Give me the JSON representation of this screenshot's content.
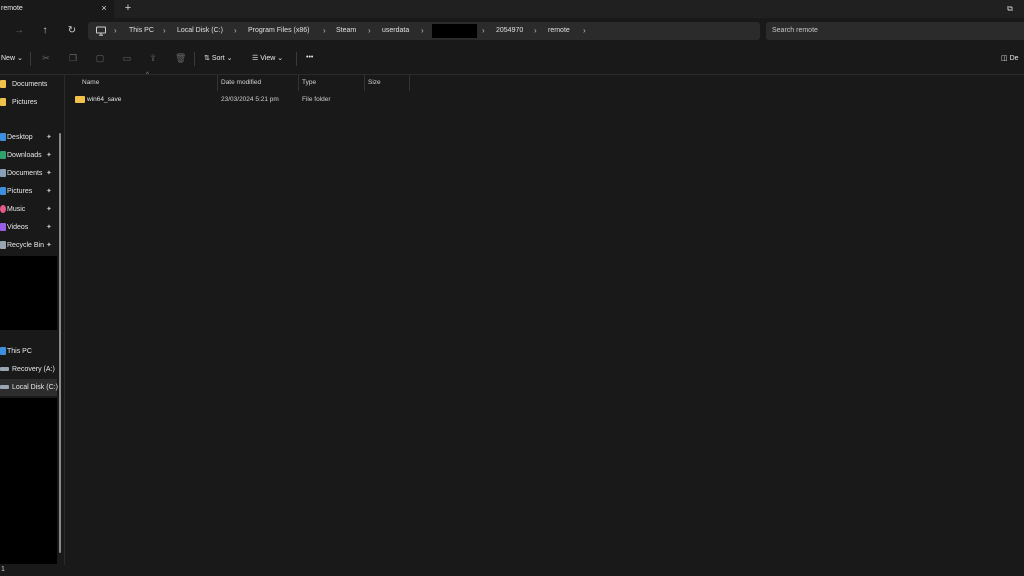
{
  "tab": {
    "title": "remote",
    "close_icon": "×",
    "new_tab_icon": "+"
  },
  "window": {
    "restore_icon": "⧉"
  },
  "nav": {
    "forward_icon": "→",
    "up_icon": "↑",
    "refresh_icon": "↻"
  },
  "breadcrumbs": [
    "This PC",
    "Local Disk (C:)",
    "Program Files (x86)",
    "Steam",
    "userdata",
    "",
    "2054970",
    "remote"
  ],
  "search": {
    "placeholder": "Search remote"
  },
  "toolbar": {
    "new_label": "New",
    "sort_label": "Sort",
    "view_label": "View",
    "more_label": "•••",
    "details_label": "De"
  },
  "sidebar": {
    "quick": [
      {
        "label": "Documents",
        "color": "#f0c24b"
      },
      {
        "label": "Pictures",
        "color": "#f0c24b"
      }
    ],
    "pinned": [
      {
        "label": "Desktop",
        "color": "#3d8fe0",
        "pin": "✦"
      },
      {
        "label": "Downloads",
        "color": "#2fa36b",
        "pin": "✦"
      },
      {
        "label": "Documents",
        "color": "#8aa0b8",
        "pin": "✦"
      },
      {
        "label": "Pictures",
        "color": "#3d8fe0",
        "pin": "✦"
      },
      {
        "label": "Music",
        "color": "#e05a8a",
        "pin": "✦"
      },
      {
        "label": "Videos",
        "color": "#9b5de5",
        "pin": "✦"
      },
      {
        "label": "Recycle Bin",
        "color": "#9aa6b2",
        "pin": "✦"
      }
    ],
    "drives": [
      {
        "label": "This PC",
        "color": "#3d8fe0"
      },
      {
        "label": "Recovery (A:)",
        "color": "#9aa6b2"
      },
      {
        "label": "Local Disk (C:)",
        "color": "#9aa6b2"
      }
    ]
  },
  "columns": {
    "name": "Name",
    "date": "Date modified",
    "type": "Type",
    "size": "Size"
  },
  "files": [
    {
      "name": "win64_save",
      "date": "23/03/2024 5:21 pm",
      "type": "File folder",
      "size": ""
    }
  ],
  "status": {
    "text": "1"
  }
}
